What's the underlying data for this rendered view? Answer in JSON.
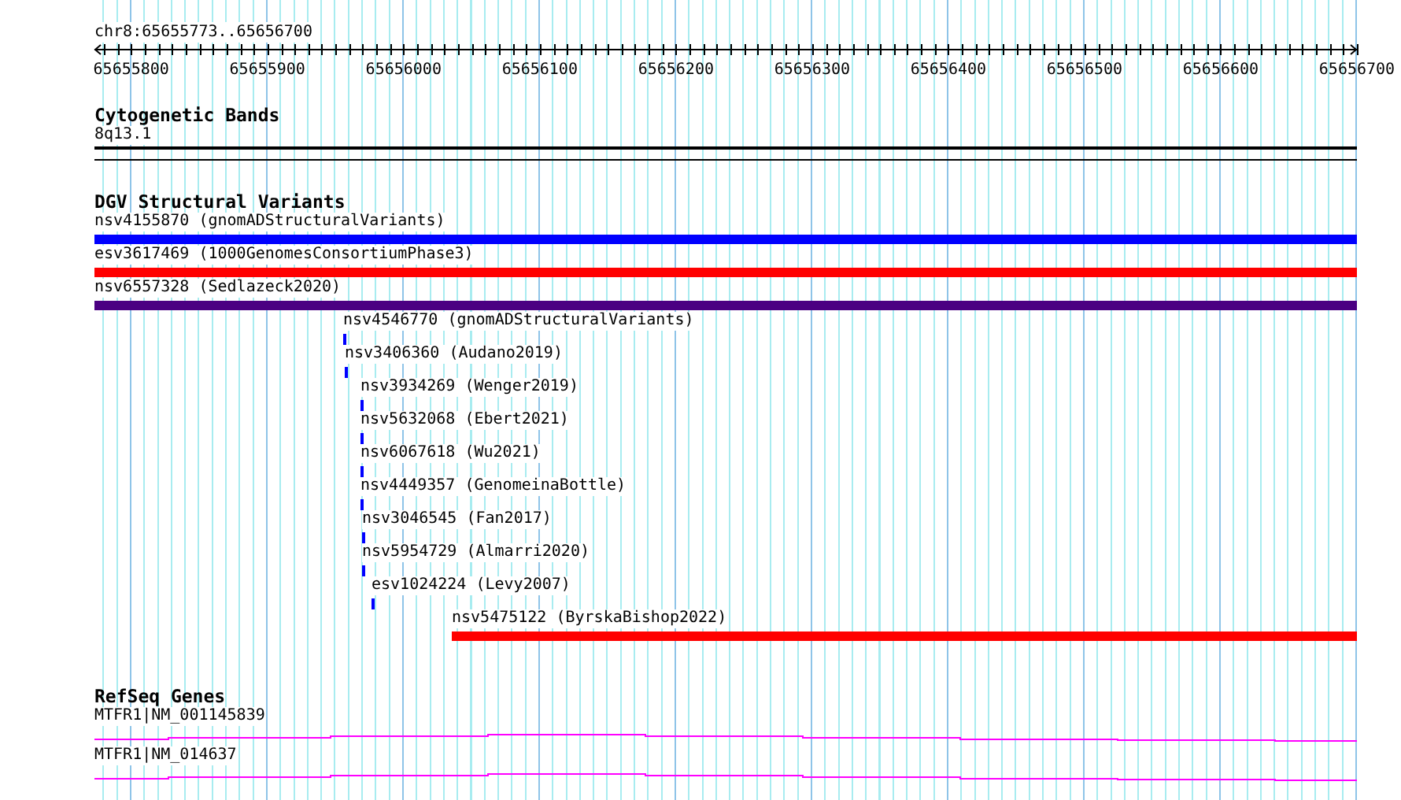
{
  "ruler": {
    "location": "chr8:65655773..65656700",
    "tick_labels": [
      "65655800",
      "65655900",
      "65656000",
      "65656100",
      "65656200",
      "65656300",
      "65656400",
      "65656500",
      "65656600",
      "65656700"
    ]
  },
  "tracks": [
    {
      "kind": "cytoband",
      "title": "Cytogenetic Bands",
      "features": [
        {
          "label": "8q13.1"
        }
      ]
    },
    {
      "kind": "variants",
      "title": "DGV Structural Variants",
      "features": [
        {
          "label": "nsv4155870 (gnomADStructuralVariants)",
          "color": "#0000ff"
        },
        {
          "label": "esv3617469 (1000GenomesConsortiumPhase3)",
          "color": "#ff0000"
        },
        {
          "label": "nsv6557328 (Sedlazeck2020)",
          "color": "#4b0082"
        },
        {
          "label": "nsv4546770 (gnomADStructuralVariants)",
          "color": "#0000ff"
        },
        {
          "label": "nsv3406360 (Audano2019)",
          "color": "#0000ff"
        },
        {
          "label": "nsv3934269 (Wenger2019)",
          "color": "#0000ff"
        },
        {
          "label": "nsv5632068 (Ebert2021)",
          "color": "#0000ff"
        },
        {
          "label": "nsv6067618 (Wu2021)",
          "color": "#0000ff"
        },
        {
          "label": "nsv4449357 (GenomeinaBottle)",
          "color": "#0000ff"
        },
        {
          "label": "nsv3046545 (Fan2017)",
          "color": "#0000ff"
        },
        {
          "label": "nsv5954729 (Almarri2020)",
          "color": "#0000ff"
        },
        {
          "label": "esv1024224 (Levy2007)",
          "color": "#0000ff"
        },
        {
          "label": "nsv5475122 (ByrskaBishop2022)",
          "color": "#ff0000"
        }
      ]
    },
    {
      "kind": "genes",
      "title": "RefSeq Genes",
      "features": [
        {
          "label": "MTFR1|NM_001145839"
        },
        {
          "label": "MTFR1|NM_014637"
        }
      ]
    }
  ]
}
